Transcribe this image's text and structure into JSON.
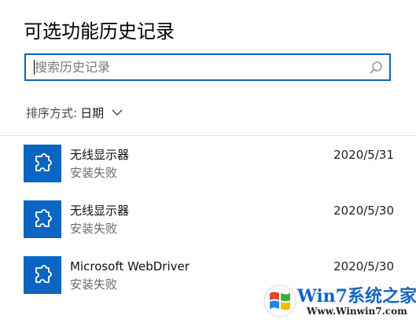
{
  "header": {
    "title": "可选功能历史记录"
  },
  "search": {
    "placeholder": "搜索历史记录",
    "value": ""
  },
  "sort": {
    "label": "排序方式:",
    "value": "日期"
  },
  "history": [
    {
      "name": "无线显示器",
      "status": "安装失败",
      "date": "2020/5/31",
      "icon": "puzzle-piece-icon"
    },
    {
      "name": "无线显示器",
      "status": "安装失败",
      "date": "2020/5/30",
      "icon": "puzzle-piece-icon"
    },
    {
      "name": "Microsoft WebDriver",
      "status": "安装失败",
      "date": "2020/5/30",
      "icon": "puzzle-piece-icon"
    }
  ],
  "watermark": {
    "brand": "Win7系统之家",
    "url": "Www.Winwin7.com"
  },
  "colors": {
    "accent": "#0a64b4",
    "tile": "#0a66c2"
  }
}
